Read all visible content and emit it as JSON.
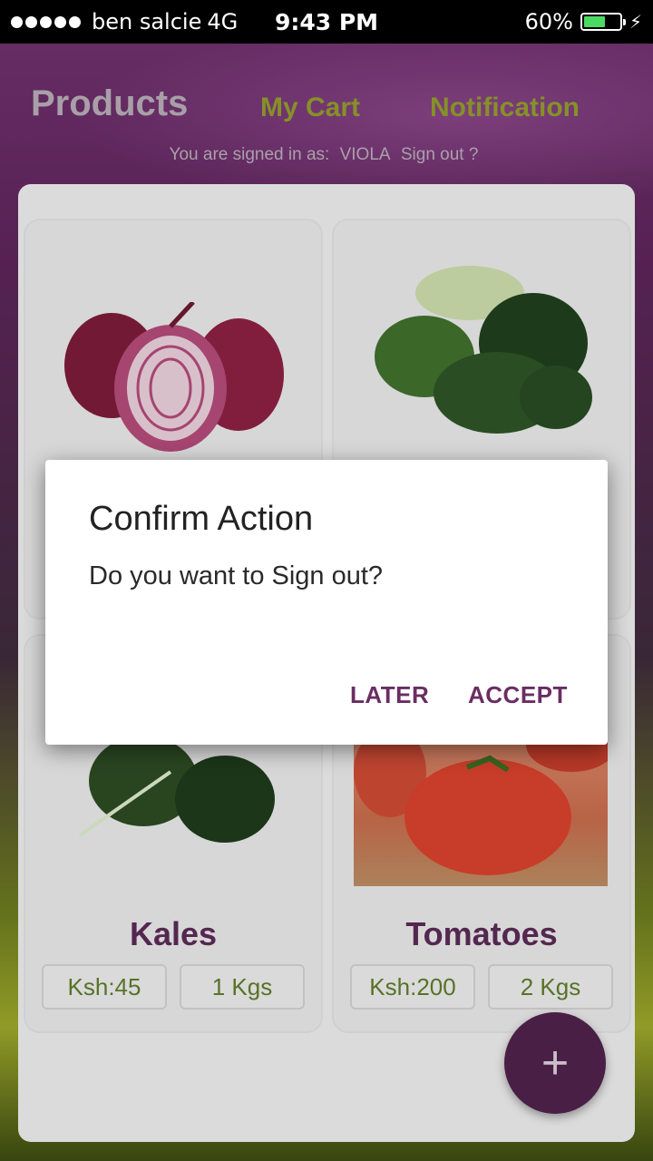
{
  "status_bar": {
    "carrier": "ben salcie",
    "network": "4G",
    "time": "9:43 PM",
    "battery": "60%",
    "battery_level": 0.6
  },
  "header": {
    "tabs": [
      "Products",
      "My Cart",
      "Notification"
    ],
    "signed_in_prefix": "You are signed in as:",
    "username": "VIOLA",
    "signout_link": "Sign out ?"
  },
  "products": [
    {
      "name": "",
      "image": "onion-image"
    },
    {
      "name": "",
      "image": "greens-image"
    },
    {
      "name": "Kales",
      "price": "Ksh:45",
      "qty": "1 Kgs",
      "image": "kales-image"
    },
    {
      "name": "Tomatoes",
      "price": "Ksh:200",
      "qty": "2 Kgs",
      "image": "tomato-image"
    }
  ],
  "fab": {
    "label": "+",
    "icon": "plus-icon"
  },
  "dialog": {
    "title": "Confirm Action",
    "message": "Do you want to Sign out?",
    "cancel_label": "LATER",
    "confirm_label": "ACCEPT"
  },
  "colors": {
    "accent": "#6a2d63",
    "nav_inactive": "#8f9a2c",
    "price_text": "#5e7a2a"
  }
}
